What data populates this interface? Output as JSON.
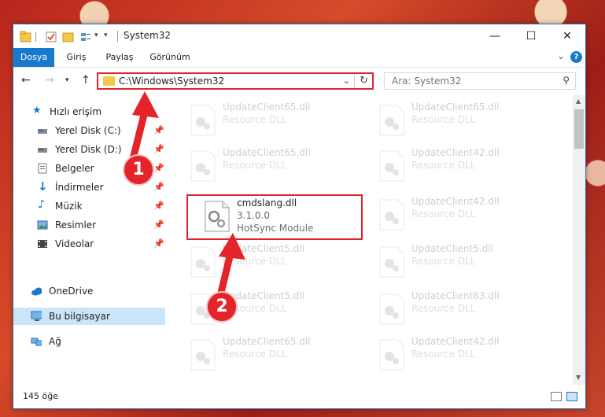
{
  "window": {
    "title": "System32",
    "close_glyph": "✕",
    "maximize_glyph": "☐",
    "minimize_glyph": "—"
  },
  "ribbon": {
    "tabs": [
      {
        "label": "Dosya",
        "active": true
      },
      {
        "label": "Giriş"
      },
      {
        "label": "Paylaş"
      },
      {
        "label": "Görünüm"
      }
    ],
    "help_label": "?"
  },
  "address": {
    "path": "C:\\Windows\\System32",
    "search_placeholder": "Ara: System32"
  },
  "nav": {
    "items": [
      {
        "label": "Hızlı erişim",
        "icon": "star-icon"
      },
      {
        "label": "Yerel Disk (C:)",
        "icon": "drive-icon",
        "pinned": true
      },
      {
        "label": "Yerel Disk (D:)",
        "icon": "drive-icon",
        "pinned": true
      },
      {
        "label": "Belgeler",
        "icon": "documents-icon",
        "pinned": true
      },
      {
        "label": "İndirmeler",
        "icon": "download-icon",
        "pinned": true
      },
      {
        "label": "Müzik",
        "icon": "music-icon",
        "pinned": true
      },
      {
        "label": "Resimler",
        "icon": "pictures-icon",
        "pinned": true
      },
      {
        "label": "Videolar",
        "icon": "videos-icon",
        "pinned": true
      },
      {
        "label": "OneDrive",
        "icon": "cloud-icon"
      },
      {
        "label": "Bu bilgisayar",
        "icon": "computer-icon",
        "selected": true
      },
      {
        "label": "Ağ",
        "icon": "network-icon"
      }
    ]
  },
  "files": {
    "left": [
      {
        "name": "UpdateClient65.dll",
        "desc": "Resource DLL"
      },
      {
        "name": "UpdateClient65.dll",
        "desc": "Resource DLL"
      },
      {
        "name": "cmdslang.dll",
        "version": "3.1.0.0",
        "desc": "HotSync Module"
      },
      {
        "name": "UpdateClient5.dll",
        "desc": "Resource DLL"
      },
      {
        "name": "UpdateClient5.dll",
        "desc": "Resource DLL"
      },
      {
        "name": "UpdateClient65.dll",
        "desc": "Resource DLL"
      }
    ],
    "right": [
      {
        "name": "UpdateClient65.dll",
        "desc": "Resource DLL"
      },
      {
        "name": "UpdateClient42.dll",
        "desc": "Resource DLL"
      },
      {
        "name": "UpdateClient42.dll",
        "desc": "Resource DLL"
      },
      {
        "name": "UpdateClient5.dll",
        "desc": "Resource DLL"
      },
      {
        "name": "UpdateClient63.dll",
        "desc": "Resource DLL"
      },
      {
        "name": "UpdateClient42.dll",
        "desc": "Resource DLL"
      }
    ]
  },
  "status": {
    "count": "145 öğe"
  },
  "annotations": {
    "step1": "1",
    "step2": "2",
    "color": "#e4232a"
  },
  "colors": {
    "accent": "#1979ca",
    "highlight": "#e0222a",
    "selected_nav": "#cce4f7"
  }
}
